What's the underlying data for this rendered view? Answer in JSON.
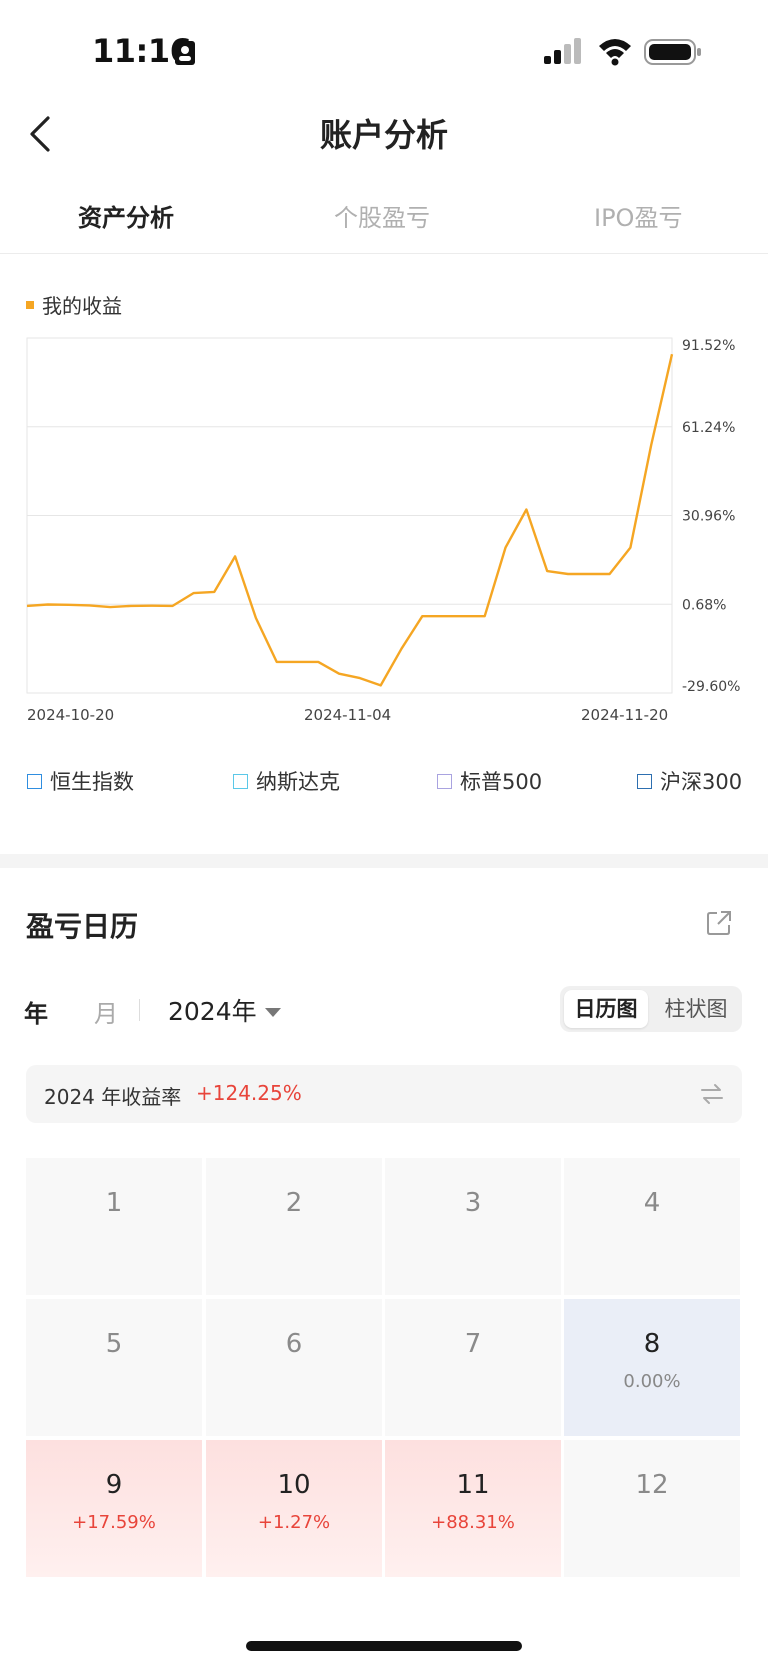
{
  "status": {
    "time": "11:16"
  },
  "nav": {
    "title": "账户分析"
  },
  "tabs": [
    {
      "label": "资产分析",
      "active": true
    },
    {
      "label": "个股盈亏",
      "active": false
    },
    {
      "label": "IPO盈亏",
      "active": false
    }
  ],
  "chart_legend": "我的收益",
  "chart_data": {
    "type": "line",
    "series": [
      {
        "name": "我的收益",
        "color": "#f5a623",
        "values": [
          0.1,
          0.6,
          0.5,
          0.3,
          -0.3,
          0.1,
          0.2,
          0.1,
          4.5,
          4.9,
          17.0,
          -4.0,
          -19.0,
          -19.0,
          -19.0,
          -23.0,
          -24.5,
          -27.0,
          -14.5,
          -3.4,
          -3.4,
          -3.4,
          -3.4,
          20.0,
          33.0,
          12.0,
          11.0,
          11.0,
          11.0,
          20.0,
          55.0,
          86.0
        ]
      }
    ],
    "x_tick_labels": [
      "2024-10-20",
      "2024-11-04",
      "2024-11-20"
    ],
    "y_tick_labels": [
      "91.52%",
      "61.24%",
      "30.96%",
      "0.68%",
      "-29.60%"
    ],
    "y_ticks": [
      91.52,
      61.24,
      30.96,
      0.68,
      -29.6
    ],
    "ylim": [
      -29.6,
      91.52
    ],
    "grid": true
  },
  "indices": [
    {
      "label": "恒生指数",
      "color": "#2f8ee0"
    },
    {
      "label": "纳斯达克",
      "color": "#5bc8e8"
    },
    {
      "label": "标普500",
      "color": "#a9a3e0"
    },
    {
      "label": "沪深300",
      "color": "#2d6fb0"
    }
  ],
  "calendar": {
    "title": "盈亏日历",
    "period_year": "年",
    "period_month": "月",
    "year_select": "2024年",
    "view_calendar": "日历图",
    "view_bar": "柱状图",
    "yield_label": "2024 年收益率",
    "yield_value": "+124.25%",
    "months": [
      {
        "n": "1",
        "pct": "",
        "state": "empty"
      },
      {
        "n": "2",
        "pct": "",
        "state": "empty"
      },
      {
        "n": "3",
        "pct": "",
        "state": "empty"
      },
      {
        "n": "4",
        "pct": "",
        "state": "empty"
      },
      {
        "n": "5",
        "pct": "",
        "state": "empty"
      },
      {
        "n": "6",
        "pct": "",
        "state": "empty"
      },
      {
        "n": "7",
        "pct": "",
        "state": "empty"
      },
      {
        "n": "8",
        "pct": "0.00%",
        "state": "neutral"
      },
      {
        "n": "9",
        "pct": "+17.59%",
        "state": "gain"
      },
      {
        "n": "10",
        "pct": "+1.27%",
        "state": "gain"
      },
      {
        "n": "11",
        "pct": "+88.31%",
        "state": "gain"
      },
      {
        "n": "12",
        "pct": "",
        "state": "empty"
      }
    ]
  }
}
